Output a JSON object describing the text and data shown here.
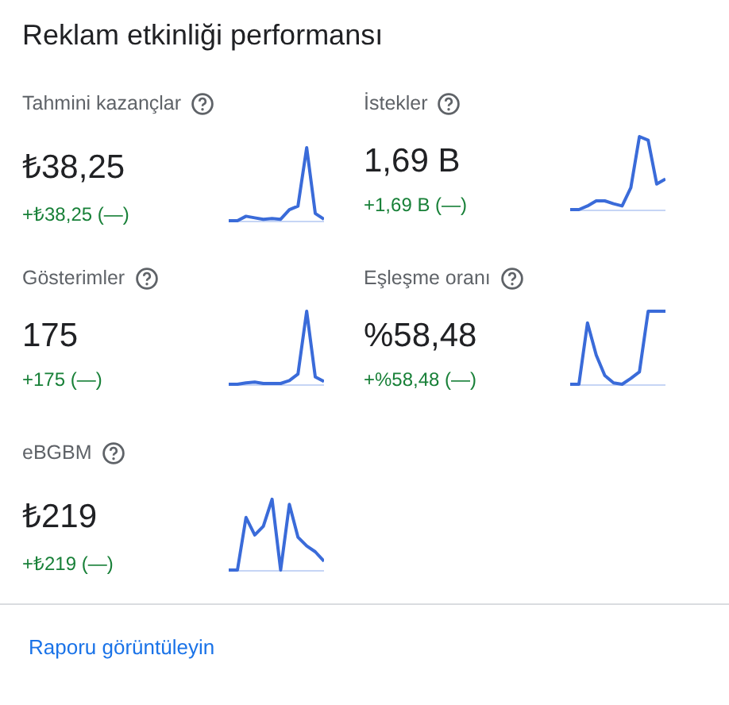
{
  "title": "Reklam etkinliği performansı",
  "metrics": [
    {
      "label": "Tahmini kazançlar",
      "value": "₺38,25",
      "change": "+₺38,25 (—)"
    },
    {
      "label": "İstekler",
      "value": "1,69 B",
      "change": "+1,69 B (—)"
    },
    {
      "label": "Gösterimler",
      "value": "175",
      "change": "+175 (—)"
    },
    {
      "label": "Eşleşme oranı",
      "value": "%58,48",
      "change": "+%58,48 (—)"
    },
    {
      "label": "eBGBM",
      "value": "₺219",
      "change": "+₺219 (—)"
    }
  ],
  "link": "Raporu görüntüleyin"
}
